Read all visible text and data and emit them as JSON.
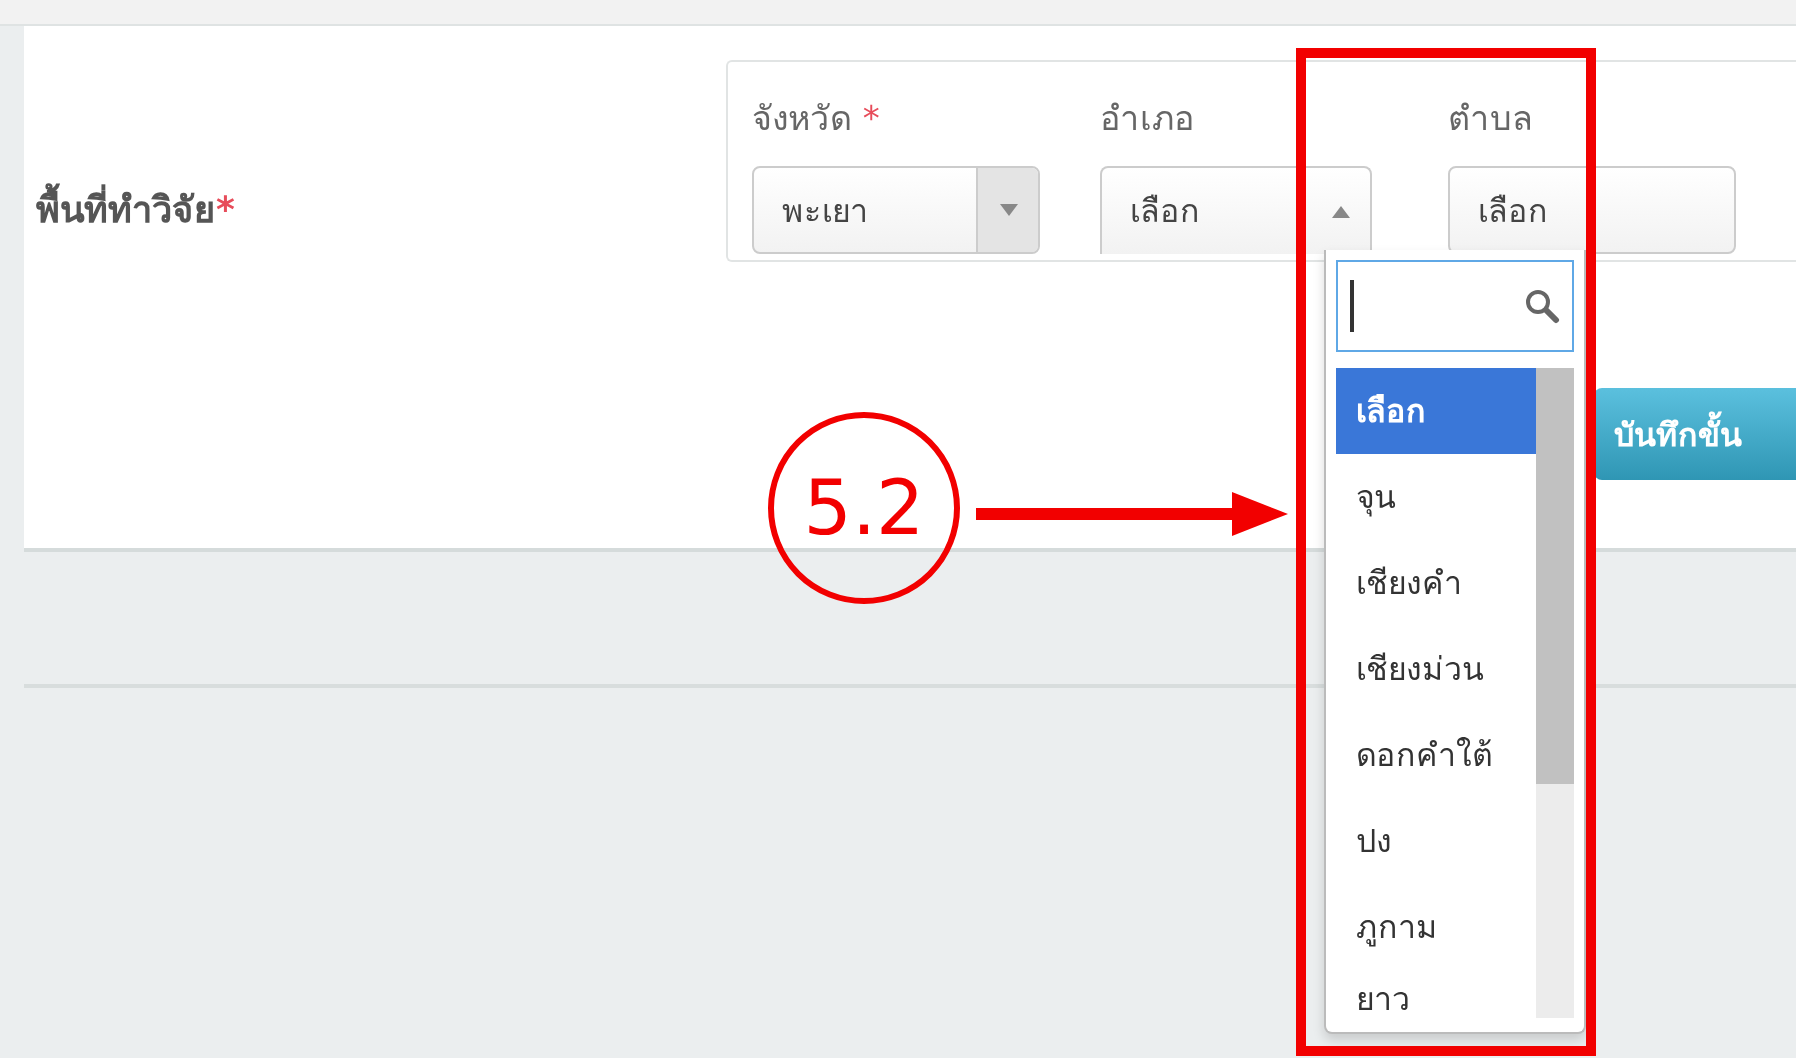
{
  "field": {
    "label": "พื้นที่ทำวิจัย",
    "required_mark": "*"
  },
  "selects": [
    {
      "label": "จังหวัด",
      "required_mark": "*",
      "value": "พะเยา",
      "open": false
    },
    {
      "label": "อำเภอ",
      "value": "เลือก",
      "open": true
    },
    {
      "label": "ตำบล",
      "value": "เลือก",
      "open": false
    }
  ],
  "dropdown": {
    "options": [
      {
        "label": "เลือก",
        "selected": true
      },
      {
        "label": "จุน",
        "selected": false
      },
      {
        "label": "เชียงคำ",
        "selected": false
      },
      {
        "label": "เชียงม่วน",
        "selected": false
      },
      {
        "label": "ดอกคำใต้",
        "selected": false
      },
      {
        "label": "ปง",
        "selected": false
      },
      {
        "label": "ภูกาม",
        "selected": false
      },
      {
        "label": "ยาว",
        "selected": false
      }
    ]
  },
  "save_button": "บันทึกขั้น",
  "annotation": {
    "label": "5.2"
  }
}
